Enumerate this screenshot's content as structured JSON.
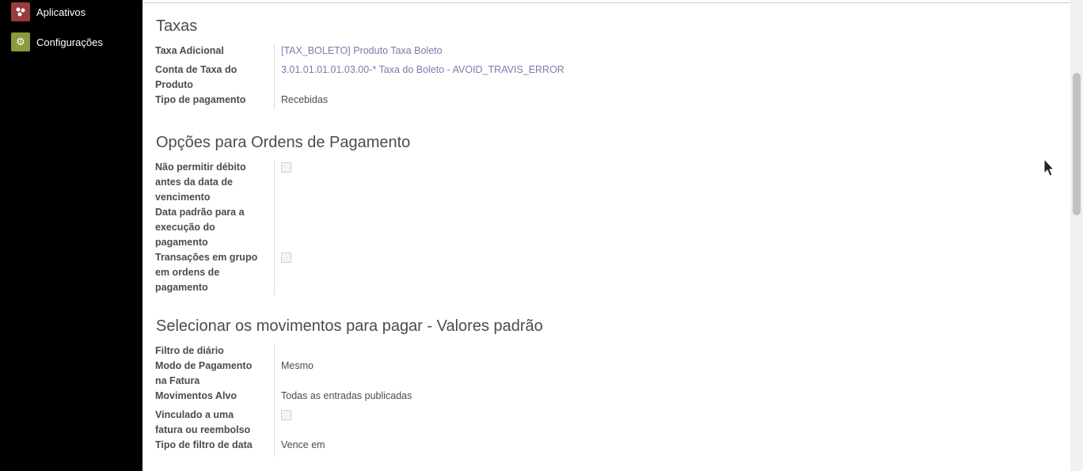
{
  "sidebar": {
    "items": [
      {
        "label": "Aplicativos",
        "icon": "puzzle-icon",
        "color": "#9b3a3e"
      },
      {
        "label": "Configurações",
        "icon": "gear-icon",
        "color": "#8a9a3c"
      }
    ]
  },
  "sections": {
    "taxas": {
      "title": "Taxas",
      "taxa_adicional_label": "Taxa Adicional",
      "taxa_adicional_value": "[TAX_BOLETO] Produto Taxa Boleto",
      "conta_taxa_label": "Conta de Taxa do Produto",
      "conta_taxa_value": "3.01.01.01.01.03.00-* Taxa do Boleto - AVOID_TRAVIS_ERROR",
      "tipo_pagamento_label": "Tipo de pagamento",
      "tipo_pagamento_value": "Recebidas"
    },
    "opcoes": {
      "title": "Opções para Ordens de Pagamento",
      "nao_permitir_label": "Não permitir débito antes da data de vencimento",
      "nao_permitir_checked": false,
      "data_padrao_label": "Data padrão para a execução do pagamento",
      "transacoes_label": "Transações em grupo em ordens de pagamento",
      "transacoes_checked": false
    },
    "movimentos": {
      "title": "Selecionar os movimentos para pagar - Valores padrão",
      "filtro_diario_label": "Filtro de diário",
      "modo_pagamento_label": "Modo de Pagamento na Fatura",
      "modo_pagamento_value": "Mesmo",
      "movimentos_alvo_label": "Movimentos Alvo",
      "movimentos_alvo_value": "Todas as entradas publicadas",
      "vinculado_label": "Vinculado a uma fatura ou reembolso",
      "vinculado_checked": false,
      "tipo_filtro_label": "Tipo de filtro de data",
      "tipo_filtro_value": "Vence em"
    }
  }
}
